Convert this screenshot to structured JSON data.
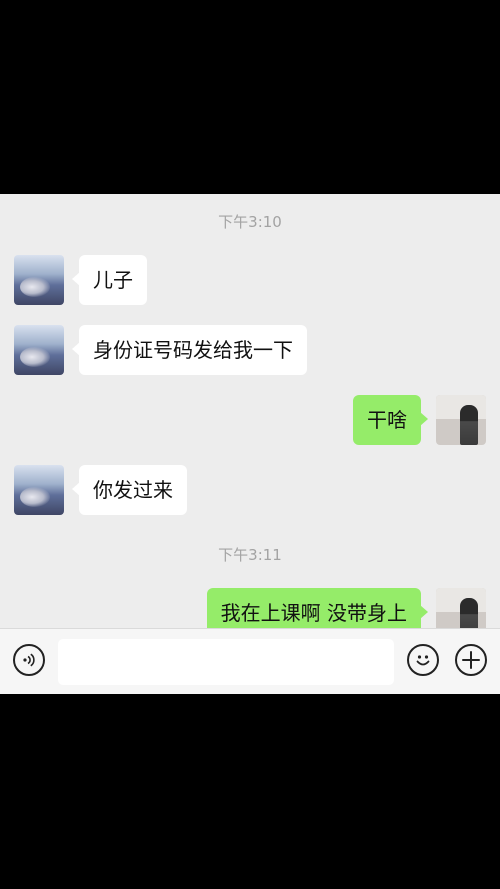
{
  "chat": {
    "timestamps": [
      "下午3:10",
      "下午3:11"
    ],
    "messages": [
      {
        "side": "left",
        "text": "儿子"
      },
      {
        "side": "left",
        "text": "身份证号码发给我一下"
      },
      {
        "side": "right",
        "text": "干啥"
      },
      {
        "side": "left",
        "text": "你发过来"
      },
      {
        "side": "right",
        "text": "我在上课啊 没带身上"
      }
    ]
  },
  "input_bar": {
    "voice_icon": "voice-icon",
    "emoji_icon": "emoji-icon",
    "add_icon": "plus-icon",
    "message_value": ""
  },
  "colors": {
    "chat_background": "#ededed",
    "sent_bubble": "#95ec69",
    "received_bubble": "#ffffff",
    "timestamp_text": "#a3a3a3"
  }
}
